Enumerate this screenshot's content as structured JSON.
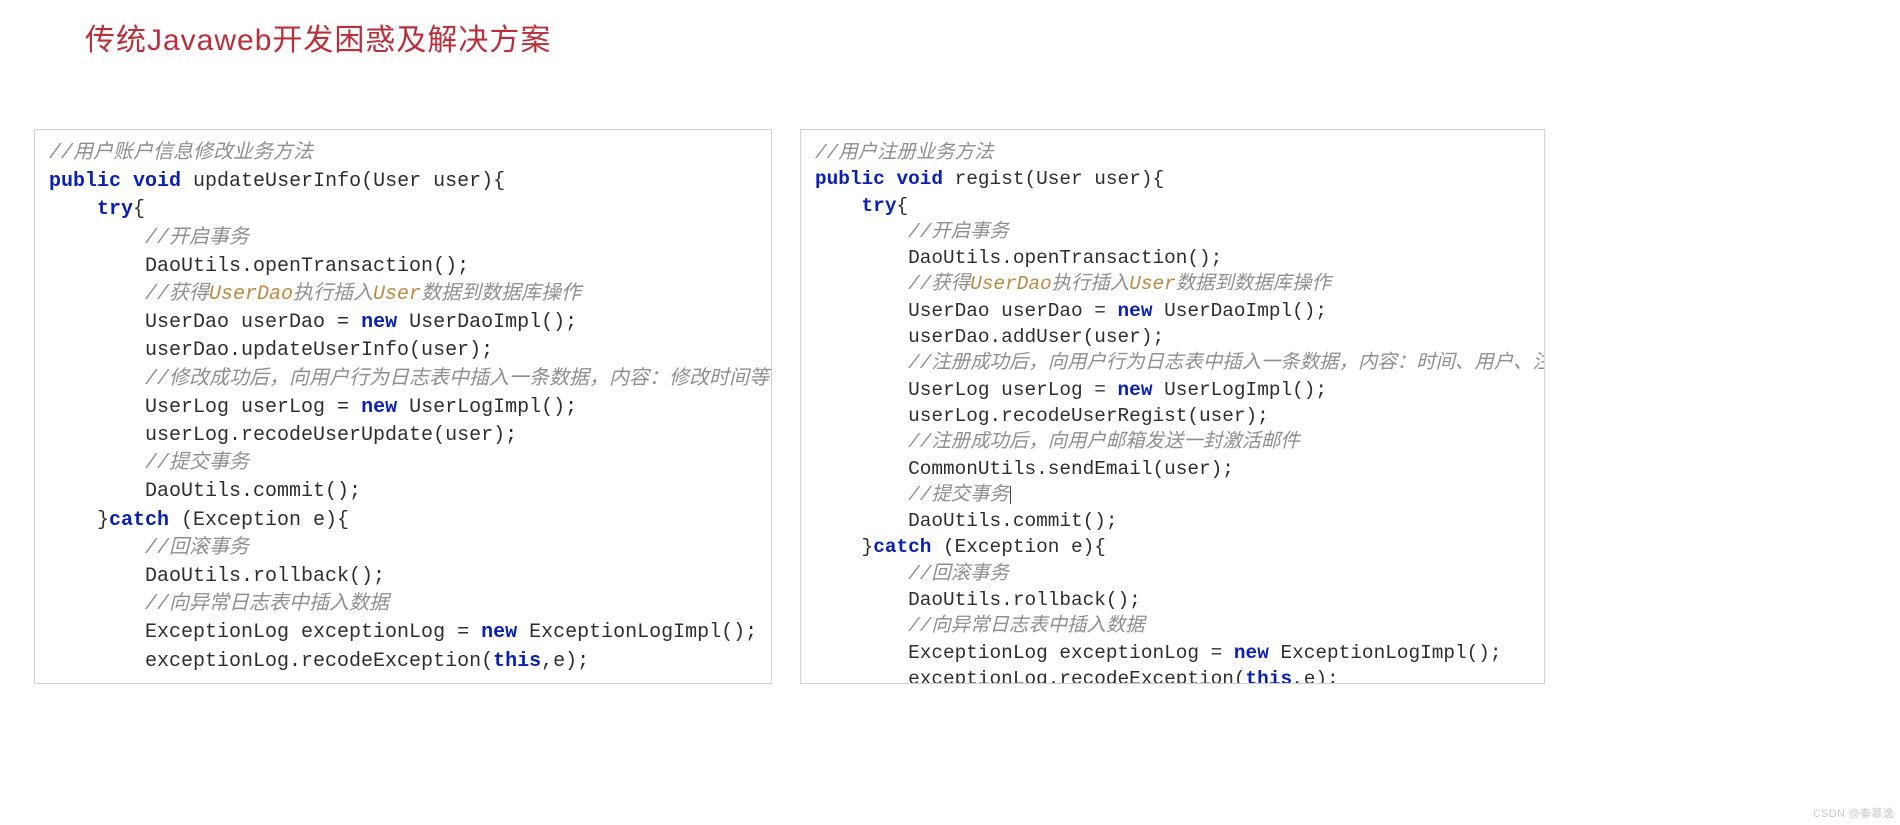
{
  "title": "传统Javaweb开发困惑及解决方案",
  "left": {
    "c1": "//用户账户信息修改业务方法",
    "kw_public": "public",
    "kw_void": "void",
    "sig": " updateUserInfo(User user){",
    "kw_try": "try",
    "brace_open": "{",
    "c2": "//开启事务",
    "l1": "DaoUtils.openTransaction();",
    "c3a": "//获得",
    "c3b": "UserDao",
    "c3c": "执行插入",
    "c3d": "User",
    "c3e": "数据到数据库操作",
    "kw_new": "new",
    "l2a": "UserDao userDao = ",
    "l2b": " UserDaoImpl();",
    "l3": "userDao.updateUserInfo(user);",
    "c4": "//修改成功后，向用户行为日志表中插入一条数据，内容：修改时间等信息",
    "l4a": "UserLog userLog = ",
    "l4b": " UserLogImpl();",
    "l5": "userLog.recodeUserUpdate(user);",
    "c5": "//提交事务",
    "l6": "DaoUtils.commit();",
    "kw_catch": "catch",
    "catch_tail": " (Exception e){",
    "c6": "//回滚事务",
    "l7": "DaoUtils.rollback();",
    "c7": "//向异常日志表中插入数据",
    "l8a": "ExceptionLog exceptionLog = ",
    "l8b": " ExceptionLogImpl();",
    "kw_this": "this",
    "l9a": "exceptionLog.recodeException(",
    "l9b": ",e);"
  },
  "right": {
    "c1": "//用户注册业务方法",
    "kw_public": "public",
    "kw_void": "void",
    "sig": " regist(User user){",
    "kw_try": "try",
    "brace_open": "{",
    "c2": "//开启事务",
    "l1": "DaoUtils.openTransaction();",
    "c3a": "//获得",
    "c3b": "UserDao",
    "c3c": "执行插入",
    "c3d": "User",
    "c3e": "数据到数据库操作",
    "kw_new": "new",
    "l2a": "UserDao userDao = ",
    "l2b": " UserDaoImpl();",
    "l3": "userDao.addUser(user);",
    "c4": "//注册成功后，向用户行为日志表中插入一条数据，内容：时间、用户、注册行为",
    "l4a": "UserLog userLog = ",
    "l4b": " UserLogImpl();",
    "l5": "userLog.recodeUserRegist(user);",
    "c4b": "//注册成功后，向用户邮箱发送一封激活邮件",
    "l5b": "CommonUtils.sendEmail(user);",
    "c5": "//提交事务",
    "l6": "DaoUtils.commit();",
    "kw_catch": "catch",
    "catch_tail": " (Exception e){",
    "c6": "//回滚事务",
    "l7": "DaoUtils.rollback();",
    "c7": "//向异常日志表中插入数据",
    "l8a": "ExceptionLog exceptionLog = ",
    "l8b": " ExceptionLogImpl();",
    "kw_this": "this",
    "l9a": "exceptionLog.recodeException(",
    "l9b": ",e);"
  },
  "watermark": "CSDN @秦慕逸"
}
